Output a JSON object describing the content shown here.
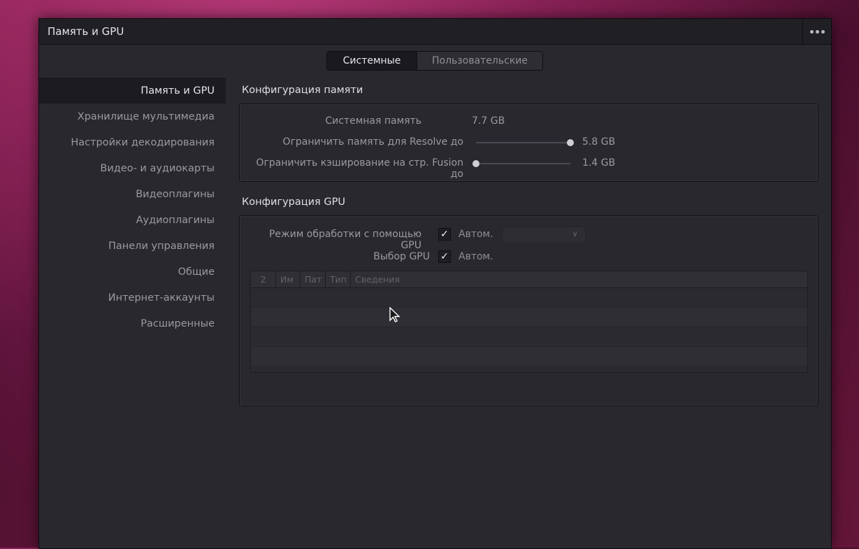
{
  "window": {
    "title": "Память и GPU"
  },
  "tabs": [
    {
      "label": "Системные",
      "active": true
    },
    {
      "label": "Пользовательские",
      "active": false
    }
  ],
  "sidebar": {
    "items": [
      {
        "label": "Память и GPU",
        "active": true
      },
      {
        "label": "Хранилище мультимедиа"
      },
      {
        "label": "Настройки декодирования"
      },
      {
        "label": "Видео- и аудиокарты"
      },
      {
        "label": "Видеоплагины"
      },
      {
        "label": "Аудиоплагины"
      },
      {
        "label": "Панели управления"
      },
      {
        "label": "Общие"
      },
      {
        "label": "Интернет-аккаунты"
      },
      {
        "label": "Расширенные"
      }
    ]
  },
  "memory": {
    "title": "Конфигурация памяти",
    "system_label": "Системная память",
    "system_value": "7.7 GB",
    "resolve_label": "Ограничить память для Resolve до",
    "resolve_value": "5.8 GB",
    "resolve_fraction": 1.0,
    "fusion_label": "Ограничить кэширование на стр. Fusion до",
    "fusion_value": "1.4 GB",
    "fusion_fraction": 0.0
  },
  "gpu": {
    "title": "Конфигурация GPU",
    "mode_label": "Режим обработки с помощью GPU",
    "mode_checked": true,
    "mode_auto": "Автом.",
    "select_label": "Выбор GPU",
    "select_checked": true,
    "select_auto": "Автом.",
    "table": {
      "columns": [
        "2",
        "Им",
        "Пат",
        "Тип",
        "Сведения"
      ]
    }
  },
  "checkmark": "✓",
  "colors": {
    "background": "#28282e",
    "titlebar": "#1f1f24",
    "accent_text": "#e6e6ea"
  }
}
